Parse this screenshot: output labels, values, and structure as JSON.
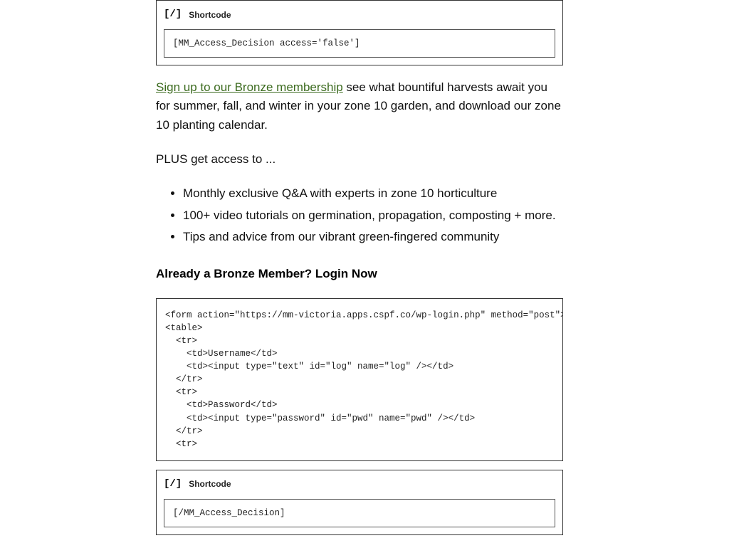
{
  "shortcode_block_1": {
    "icon": "[/]",
    "label": "Shortcode",
    "content": "[MM_Access_Decision access='false']"
  },
  "para_1": {
    "link_text": "Sign up to our Bronze membership",
    "rest": " see what bountiful harvests await you for summer, fall, and winter in your zone 10 garden, and download our zone 10 planting calendar."
  },
  "para_2": "PLUS get access to ...",
  "bullets": [
    "Monthly exclusive Q&A with experts in zone 10 horticulture",
    "100+ video tutorials on germination, propagation, composting + more.",
    "Tips and advice from our vibrant green-fingered community"
  ],
  "subhead": "Already a Bronze Member? Login Now",
  "code_block": "<form action=\"https://mm-victoria.apps.cspf.co/wp-login.php\" method=\"post\">\n<table>\n  <tr>\n    <td>Username</td>\n    <td><input type=\"text\" id=\"log\" name=\"log\" /></td>\n  </tr>\n  <tr>\n    <td>Password</td>\n    <td><input type=\"password\" id=\"pwd\" name=\"pwd\" /></td>\n  </tr>\n  <tr>",
  "shortcode_block_2": {
    "icon": "[/]",
    "label": "Shortcode",
    "content": "[/MM_Access_Decision]"
  }
}
